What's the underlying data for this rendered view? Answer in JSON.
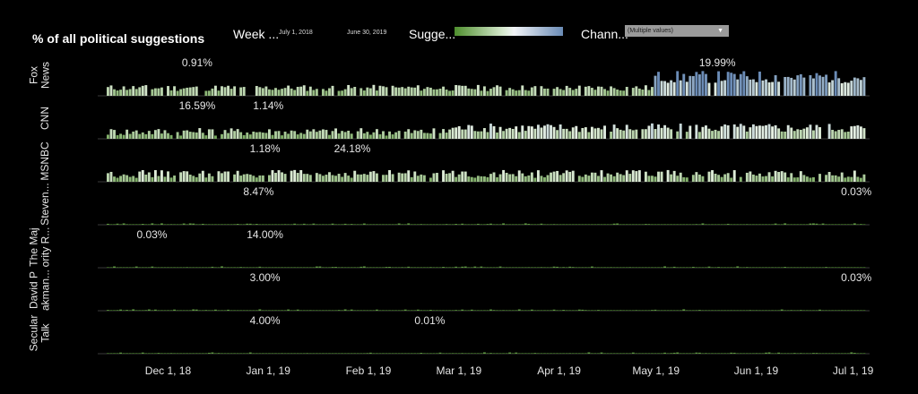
{
  "header": {
    "title": "% of all political suggestions",
    "week_label": "Week ...",
    "date_start": "July 1, 2018",
    "date_end": "June 30, 2019",
    "suggestion_label": "Sugge...",
    "channel_label": "Chann...",
    "channel_value": "(Multiple values)"
  },
  "colors": {
    "background": "#000000",
    "low": "#4f8f2e",
    "mid": "#f2f4f7",
    "high": "#6a8bb6"
  },
  "chart_data": {
    "type": "bar",
    "x_tick_labels": [
      "Dec 1, 18",
      "Jan 1, 19",
      "Feb 1, 19",
      "Mar 1, 19",
      "Apr 1, 19",
      "May 1, 19",
      "Jun 1, 19",
      "Jul 1, 19"
    ],
    "panels": [
      {
        "row_label": [
          "Fox",
          "News"
        ],
        "annotations": [
          {
            "text": "0.91%",
            "date": "2018-12-10"
          },
          {
            "text": "19.99%",
            "date": "2019-05-20"
          }
        ]
      },
      {
        "row_label": [
          "CNN"
        ],
        "annotations": [
          {
            "text": "16.59%",
            "date": "2018-12-10"
          },
          {
            "text": "1.14%",
            "date": "2019-01-01"
          }
        ]
      },
      {
        "row_label": [
          "MSNBC"
        ],
        "annotations": [
          {
            "text": "24.18%",
            "date": "2019-01-27"
          },
          {
            "text": "1.18%",
            "date": "2018-12-31"
          }
        ]
      },
      {
        "row_label": [
          "Steven..."
        ],
        "annotations": [
          {
            "text": "8.47%",
            "date": "2018-12-29"
          },
          {
            "text": "0.03%",
            "date": "2019-07-02"
          }
        ]
      },
      {
        "row_label": [
          "The Maj",
          "ority R..."
        ],
        "annotations": [
          {
            "text": "0.03%",
            "date": "2018-11-26"
          },
          {
            "text": "14.00%",
            "date": "2018-12-31"
          }
        ]
      },
      {
        "row_label": [
          "David P",
          "akman..."
        ],
        "annotations": [
          {
            "text": "3.00%",
            "date": "2018-12-31"
          },
          {
            "text": "0.03%",
            "date": "2019-07-02"
          }
        ]
      },
      {
        "row_label": [
          "Secular",
          "Talk"
        ],
        "annotations": [
          {
            "text": "4.00%",
            "date": "2018-12-31"
          },
          {
            "text": "0.01%",
            "date": "2019-02-20"
          }
        ]
      }
    ]
  }
}
